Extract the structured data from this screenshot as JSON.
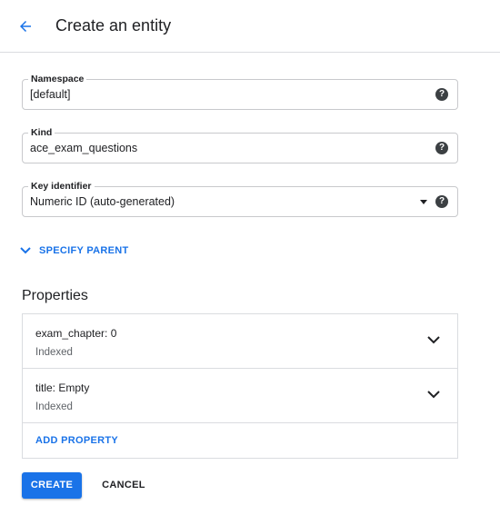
{
  "header": {
    "back_icon": "arrow-back-icon",
    "title": "Create an entity"
  },
  "form": {
    "namespace": {
      "label": "Namespace",
      "value": "[default]",
      "help_icon": "help-icon"
    },
    "kind": {
      "label": "Kind",
      "value": "ace_exam_questions",
      "help_icon": "help-icon"
    },
    "key_identifier": {
      "label": "Key identifier",
      "value": "Numeric ID (auto-generated)",
      "dropdown_icon": "arrow-drop-down-icon",
      "help_icon": "help-icon"
    }
  },
  "specify_parent": {
    "icon": "chevron-down-icon",
    "label": "SPECIFY PARENT"
  },
  "properties": {
    "title": "Properties",
    "items": [
      {
        "name": "exam_chapter:  0",
        "indexed": "Indexed"
      },
      {
        "name": "title: Empty",
        "indexed": "Indexed"
      }
    ],
    "add_label": "ADD PROPERTY"
  },
  "actions": {
    "create_label": "CREATE",
    "cancel_label": "CANCEL"
  },
  "colors": {
    "accent": "#1a73e8",
    "text": "#202124",
    "muted": "#5f6368",
    "border": "#dadce0"
  }
}
